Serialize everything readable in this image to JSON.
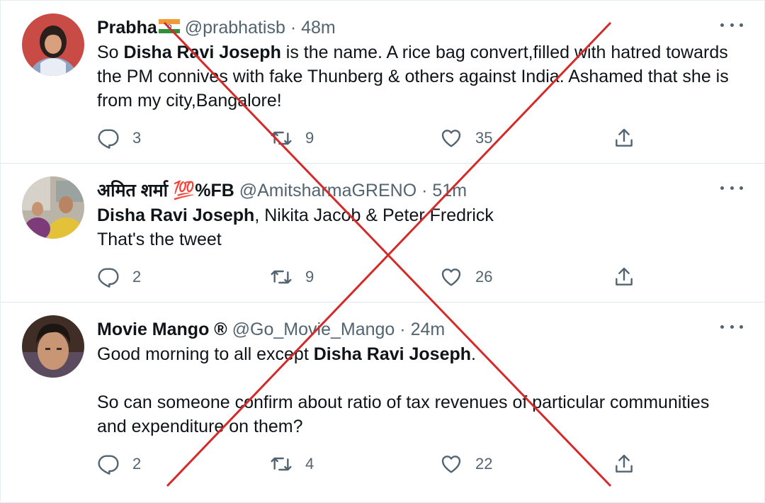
{
  "tweets": [
    {
      "name": "Prabha",
      "name_flag": "india-flag-icon",
      "handle": "@prabhatisb",
      "separator": "·",
      "time": "48m",
      "body_parts": [
        {
          "t": "So "
        },
        {
          "b": "Disha Ravi Joseph"
        },
        {
          "t": " is the name. A rice bag convert,filled with hatred towards the PM connives with fake Thunberg & others against India. Ashamed that she is from my city,Bangalore!"
        }
      ],
      "replies": "3",
      "retweets": "9",
      "likes": "35"
    },
    {
      "name": "अमित शर्मा 💯%FB",
      "handle": "@AmitsharmaGRENO",
      "separator": "·",
      "time": "51m",
      "body_lines": [
        [
          {
            "b": "Disha Ravi Joseph"
          },
          {
            "t": ", Nikita Jacob & Peter Fredrick"
          }
        ],
        [
          {
            "t": "That's the tweet"
          }
        ]
      ],
      "replies": "2",
      "retweets": "9",
      "likes": "26"
    },
    {
      "name": "Movie Mango ®",
      "handle": "@Go_Movie_Mango",
      "separator": "·",
      "time": "24m",
      "body_line1": [
        {
          "t": "Good morning to all except "
        },
        {
          "b": "Disha Ravi Joseph"
        },
        {
          "t": "."
        }
      ],
      "body_line2": "So can someone confirm about ratio of tax revenues of particular communities and expenditure on them?",
      "replies": "2",
      "retweets": "4",
      "likes": "22"
    }
  ],
  "overlay": {
    "type": "red-x-cross-mark",
    "color": "#d42a2a"
  },
  "colors": {
    "secondary_text": "#536471",
    "divider": "#e1e8ed"
  }
}
